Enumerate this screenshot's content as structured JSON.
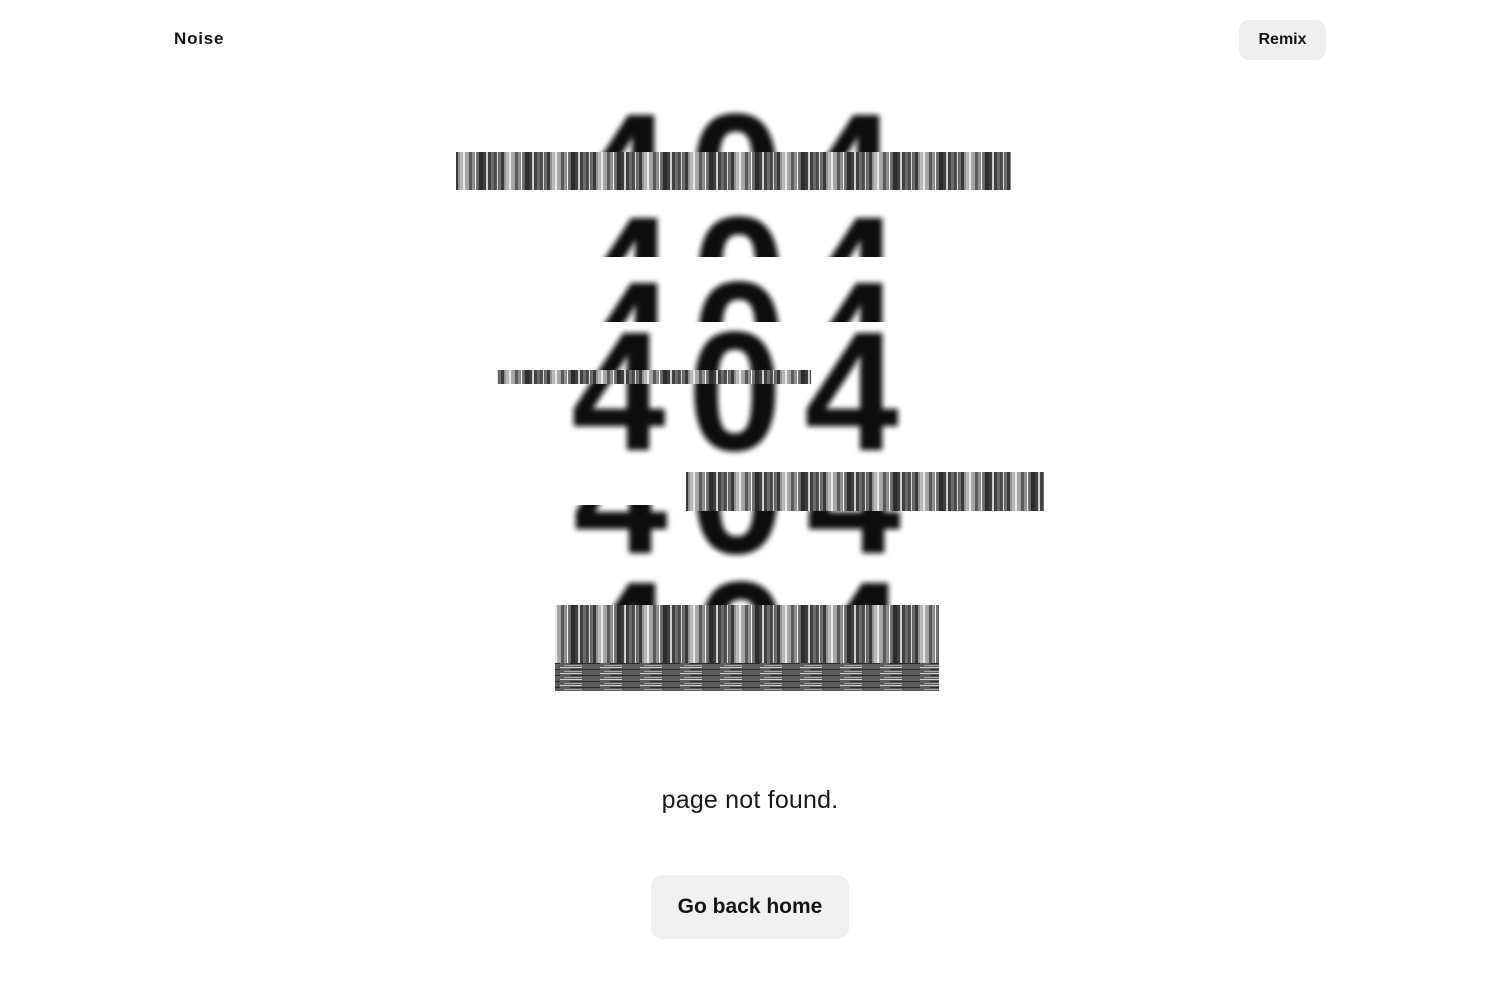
{
  "header": {
    "brand": "Noise",
    "remix_label": "Remix"
  },
  "hero": {
    "code": "404",
    "message": "page not found.",
    "home_label": "Go back home"
  },
  "colors": {
    "background": "#ffffff",
    "text": "#111111",
    "button_bg": "#efefef"
  }
}
